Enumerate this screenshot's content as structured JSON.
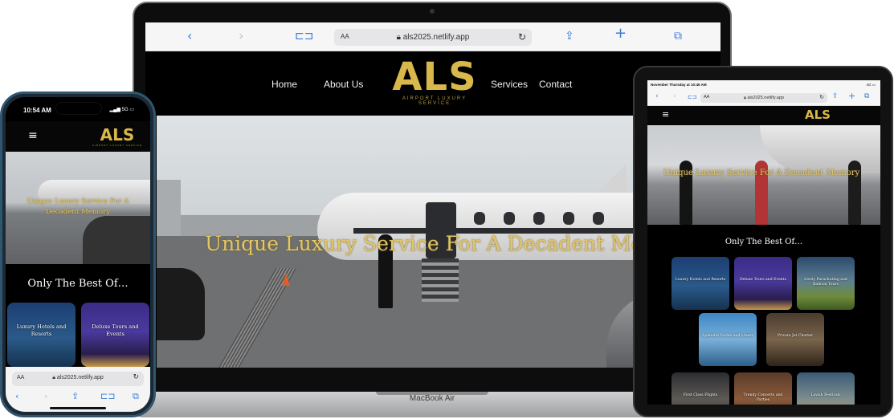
{
  "laptop": {
    "url": "als2025.netlify.app",
    "aa_label": "AA",
    "nav": {
      "home": "Home",
      "about": "About Us",
      "services": "Services",
      "contact": "Contact"
    },
    "logo": {
      "text": "ALS",
      "tagline": "AIRPORT LUXURY SERVICE"
    },
    "hero_text": "Unique Luxury Service For A Decadent Memory",
    "device_label": "MacBook Air"
  },
  "phone": {
    "time": "10:54 AM",
    "signal": "5G",
    "logo": {
      "text": "ALS",
      "tagline": "AIRPORT LUXURY SERVICE"
    },
    "hero_text": "Unique Luxury Service For A Decadent Memory",
    "section_title": "Only The Best Of…",
    "cards": [
      {
        "label": "Luxury Hotels and Resorts"
      },
      {
        "label": "Deluxe Tours and Events"
      }
    ],
    "url": "als2025.netlify.app",
    "aa_label": "AA"
  },
  "tablet": {
    "status_time": "November Thursday at 10:46 AM",
    "status_signal": "4G",
    "url": "als2025.netlify.app",
    "aa_label": "AA",
    "logo": {
      "text": "ALS"
    },
    "hero_text": "Unique Luxury Service For A Decadent Memory",
    "section_title": "Only The Best Of…",
    "cards": [
      {
        "label": "Luxury Hotels and Resorts"
      },
      {
        "label": "Deluxe Tours and Events"
      },
      {
        "label": "Lively Parachuting and Balloon Tours"
      },
      {
        "label": "Splendid Yachts and Liners"
      },
      {
        "label": "Private Jet Charter"
      },
      {
        "label": "First Class Flights"
      },
      {
        "label": "Trendy Concerts and Parties"
      },
      {
        "label": "Lavish Festivals"
      }
    ]
  },
  "colors": {
    "gold": "#d8b84a",
    "link_blue": "#3a7bd5",
    "site_bg": "#000000"
  }
}
